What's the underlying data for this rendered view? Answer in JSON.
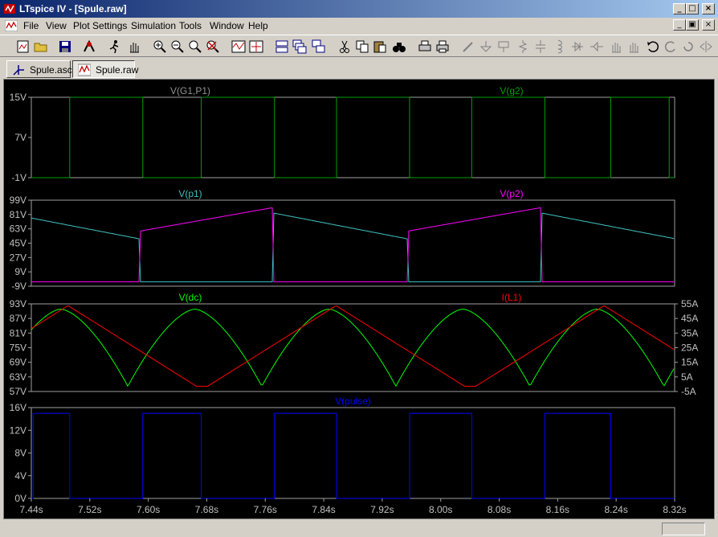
{
  "window": {
    "title": "LTspice IV - [Spule.raw]",
    "controls": {
      "minimize": "_",
      "maximize": "□",
      "close": "×",
      "restore": "▣"
    }
  },
  "menu": [
    "File",
    "View",
    "Plot Settings",
    "Simulation",
    "Tools",
    "Window",
    "Help"
  ],
  "toolbar": {
    "buttons": [
      "new-schematic",
      "open",
      "save",
      "control-panel",
      "run",
      "pan",
      "zoom-in",
      "zoom-out",
      "zoom-fit",
      "zoom-cancel",
      "autorange",
      "mark-unmark",
      "tile-horizontal",
      "cascade",
      "tile-vertical",
      "cut",
      "copy",
      "paste",
      "find",
      "print-preview",
      "print",
      "wire",
      "ground",
      "label",
      "resistor",
      "capacitor",
      "inductor",
      "diode",
      "component",
      "move",
      "drag",
      "undo",
      "redo",
      "rotate",
      "mirror"
    ]
  },
  "tabs": [
    {
      "label": "Spule.asc",
      "icon": "schematic-icon",
      "active": false
    },
    {
      "label": "Spule.raw",
      "icon": "waveform-icon",
      "active": true
    }
  ],
  "colors": {
    "background": "#000000",
    "grid": "#a0a0a0",
    "axis_text": "#c0c0c0",
    "green": "#00a000",
    "cyan": "#40c0c0",
    "magenta": "#ff00ff",
    "lime": "#00ff00",
    "red": "#ff0000",
    "blue": "#0000ff",
    "gray": "#909090"
  },
  "chart_data": [
    {
      "type": "line",
      "title": "",
      "traces": [
        {
          "name": "V(G1,P1)",
          "color": "#909090",
          "values": []
        },
        {
          "name": "V(g2)",
          "color": "#00a000",
          "x": [
            7.44,
            7.4925,
            7.4925,
            7.5925,
            7.5925,
            7.6725,
            7.6725,
            7.7725,
            7.7725,
            7.8575,
            7.8575,
            7.9575,
            7.9575,
            8.0425,
            8.0425,
            8.1425,
            8.1425,
            8.2325,
            8.2325,
            8.3125,
            8.3125,
            8.32
          ],
          "values": [
            -1,
            -1,
            15,
            15,
            -1,
            -1,
            15,
            15,
            -1,
            -1,
            15,
            15,
            -1,
            -1,
            15,
            15,
            -1,
            -1,
            15,
            15,
            -1,
            -1
          ]
        }
      ],
      "xlim": [
        7.44,
        8.32
      ],
      "ylim": [
        -1,
        15
      ],
      "y_ticks": [
        "15V",
        "7V",
        "-1V"
      ]
    },
    {
      "type": "line",
      "title": "",
      "traces": [
        {
          "name": "V(p1)",
          "color": "#40c0c0",
          "values": []
        },
        {
          "name": "V(p2)",
          "color": "#ff00ff",
          "values": []
        }
      ],
      "xlim": [
        7.44,
        8.32
      ],
      "ylim": [
        -9,
        99
      ],
      "y_ticks": [
        "99V",
        "81V",
        "63V",
        "45V",
        "27V",
        "9V",
        "-9V"
      ]
    },
    {
      "type": "line",
      "title": "",
      "traces": [
        {
          "name": "V(dc)",
          "color": "#00ff00",
          "axis": "left",
          "values": []
        },
        {
          "name": "I(L1)",
          "color": "#ff0000",
          "axis": "right",
          "values": []
        }
      ],
      "xlim": [
        7.44,
        8.32
      ],
      "ylim": [
        57,
        93
      ],
      "y2lim": [
        -5,
        55
      ],
      "y_ticks": [
        "93V",
        "87V",
        "81V",
        "75V",
        "69V",
        "63V",
        "57V"
      ],
      "y2_ticks": [
        "55A",
        "45A",
        "35A",
        "25A",
        "15A",
        "5A",
        "-5A"
      ]
    },
    {
      "type": "line",
      "title": "",
      "traces": [
        {
          "name": "V(pulse)",
          "color": "#0000ff",
          "x": [
            7.44,
            7.4425,
            7.4425,
            7.4925,
            7.4925,
            7.5925,
            7.5925,
            7.6725,
            7.6725,
            7.7725,
            7.7725,
            7.8575,
            7.8575,
            7.9575,
            7.9575,
            8.0425,
            8.0425,
            8.1425,
            8.1425,
            8.2325,
            8.2325,
            8.3125,
            8.3125,
            8.32
          ],
          "values": [
            0,
            0,
            15,
            15,
            0,
            0,
            15,
            15,
            0,
            0,
            15,
            15,
            0,
            0,
            15,
            15,
            0,
            0,
            15,
            15,
            0,
            0,
            0,
            0
          ]
        }
      ],
      "xlim": [
        7.44,
        8.32
      ],
      "ylim": [
        0,
        16
      ],
      "y_ticks": [
        "16V",
        "12V",
        "8V",
        "4V",
        "0V"
      ],
      "x_ticks": [
        "7.44s",
        "7.52s",
        "7.60s",
        "7.68s",
        "7.76s",
        "7.84s",
        "7.92s",
        "8.00s",
        "8.08s",
        "8.16s",
        "8.24s",
        "8.32s"
      ]
    }
  ]
}
